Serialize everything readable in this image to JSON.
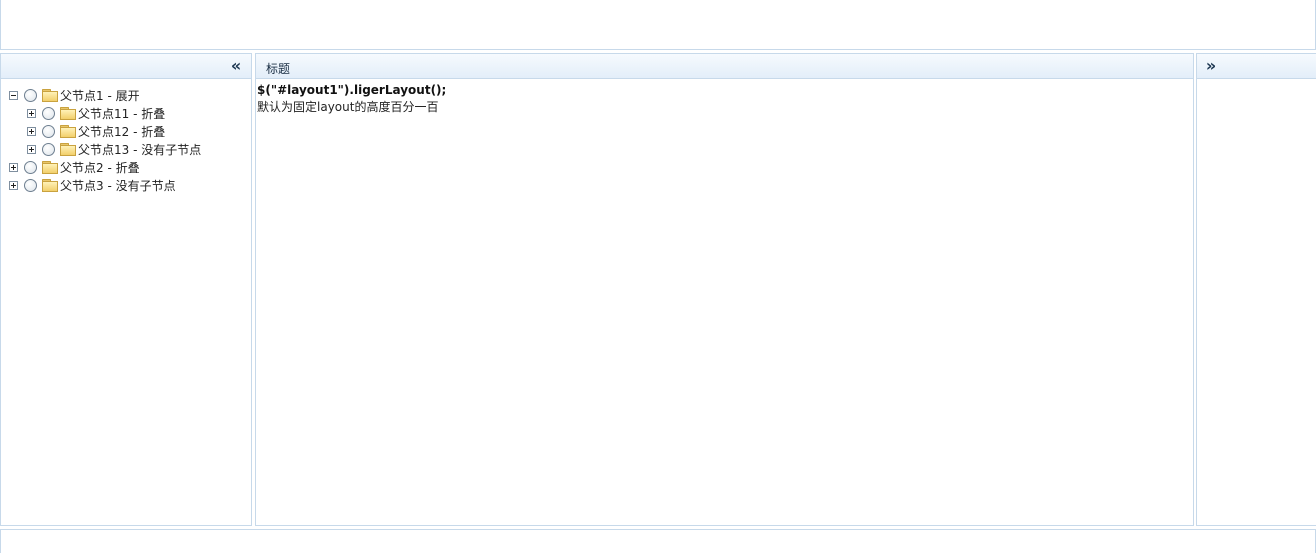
{
  "left_panel": {
    "collapse_icon": "double-chevron-left-icon",
    "collapse_glyph": "«",
    "tree": [
      {
        "label": "父节点1 - 展开",
        "level": 0,
        "toggle": "minus"
      },
      {
        "label": "父节点11 - 折叠",
        "level": 1,
        "toggle": "plus"
      },
      {
        "label": "父节点12 - 折叠",
        "level": 1,
        "toggle": "plus"
      },
      {
        "label": "父节点13 - 没有子节点",
        "level": 1,
        "toggle": "plus"
      },
      {
        "label": "父节点2 - 折叠",
        "level": 0,
        "toggle": "plus"
      },
      {
        "label": "父节点3 - 没有子节点",
        "level": 0,
        "toggle": "plus"
      }
    ]
  },
  "center_panel": {
    "title": "标题",
    "code_line": "$(\"#layout1\").ligerLayout();",
    "description": "默认为固定layout的高度百分一百"
  },
  "right_panel": {
    "expand_icon": "double-chevron-right-icon",
    "expand_glyph": "»"
  },
  "colors": {
    "border": "#c7d9ea",
    "header_gradient_top": "#f6fafe",
    "header_gradient_bottom": "#e3eef9"
  }
}
